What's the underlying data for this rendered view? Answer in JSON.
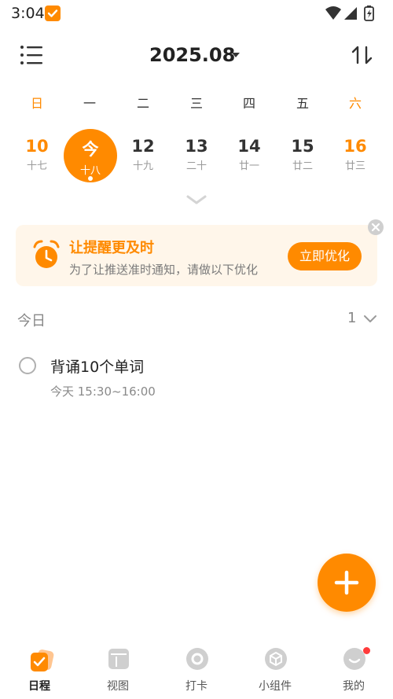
{
  "status_bar": {
    "time": "3:04"
  },
  "header": {
    "month": "2025.08"
  },
  "calendar": {
    "weekdays": [
      "日",
      "一",
      "二",
      "三",
      "四",
      "五",
      "六"
    ],
    "dates": [
      {
        "day": "10",
        "lunar": "十七"
      },
      {
        "day": "今",
        "lunar": "十八",
        "selected": true
      },
      {
        "day": "12",
        "lunar": "十九"
      },
      {
        "day": "13",
        "lunar": "二十"
      },
      {
        "day": "14",
        "lunar": "廿一"
      },
      {
        "day": "15",
        "lunar": "廿二"
      },
      {
        "day": "16",
        "lunar": "廿三"
      }
    ]
  },
  "banner": {
    "title": "让提醒更及时",
    "text": "为了让推送准时通知，请做以下优化",
    "button": "立即优化"
  },
  "section": {
    "title": "今日",
    "count": "1"
  },
  "tasks": [
    {
      "title": "背诵10个单词",
      "time": "今天 15:30~16:00"
    }
  ],
  "tabs": [
    {
      "label": "日程",
      "icon": "schedule-icon"
    },
    {
      "label": "视图",
      "icon": "view-icon"
    },
    {
      "label": "打卡",
      "icon": "checkin-icon"
    },
    {
      "label": "小组件",
      "icon": "widget-icon"
    },
    {
      "label": "我的",
      "icon": "profile-icon"
    }
  ],
  "colors": {
    "accent": "#FF8A00",
    "muted": "#9a9a9a",
    "banner_bg": "#FFF6EA"
  }
}
